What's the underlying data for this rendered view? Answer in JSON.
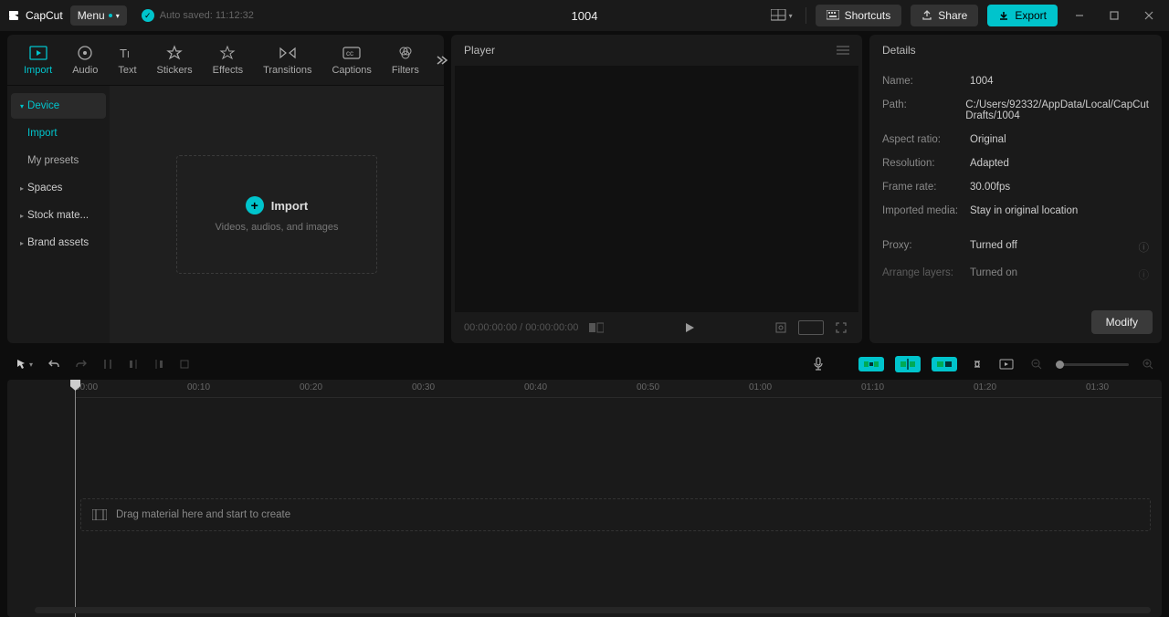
{
  "app": {
    "name": "CapCut"
  },
  "menu": {
    "label": "Menu"
  },
  "autosave": {
    "text": "Auto saved: 11:12:32"
  },
  "project": {
    "title": "1004"
  },
  "titlebar": {
    "shortcuts": "Shortcuts",
    "share": "Share",
    "export": "Export"
  },
  "navTabs": [
    {
      "label": "Import",
      "active": true
    },
    {
      "label": "Audio"
    },
    {
      "label": "Text"
    },
    {
      "label": "Stickers"
    },
    {
      "label": "Effects"
    },
    {
      "label": "Transitions"
    },
    {
      "label": "Captions"
    },
    {
      "label": "Filters"
    }
  ],
  "sidebar": {
    "device": "Device",
    "import": "Import",
    "presets": "My presets",
    "spaces": "Spaces",
    "stock": "Stock mate...",
    "brand": "Brand assets"
  },
  "importBox": {
    "label": "Import",
    "sub": "Videos, audios, and images"
  },
  "player": {
    "title": "Player",
    "time": "00:00:00:00 / 00:00:00:00"
  },
  "details": {
    "title": "Details",
    "rows": {
      "nameLabel": "Name:",
      "nameValue": "1004",
      "pathLabel": "Path:",
      "pathValue": "C:/Users/92332/AppData/Local/CapCut Drafts/1004",
      "aspectLabel": "Aspect ratio:",
      "aspectValue": "Original",
      "resLabel": "Resolution:",
      "resValue": "Adapted",
      "fpsLabel": "Frame rate:",
      "fpsValue": "30.00fps",
      "mediaLabel": "Imported media:",
      "mediaValue": "Stay in original location",
      "proxyLabel": "Proxy:",
      "proxyValue": "Turned off",
      "layersLabel": "Arrange layers:",
      "layersValue": "Turned on"
    },
    "modify": "Modify"
  },
  "timeline": {
    "dropHint": "Drag material here and start to create",
    "marks": [
      "00:00",
      "00:10",
      "00:20",
      "00:30",
      "00:40",
      "00:50",
      "01:00",
      "01:10",
      "01:20",
      "01:30"
    ]
  }
}
